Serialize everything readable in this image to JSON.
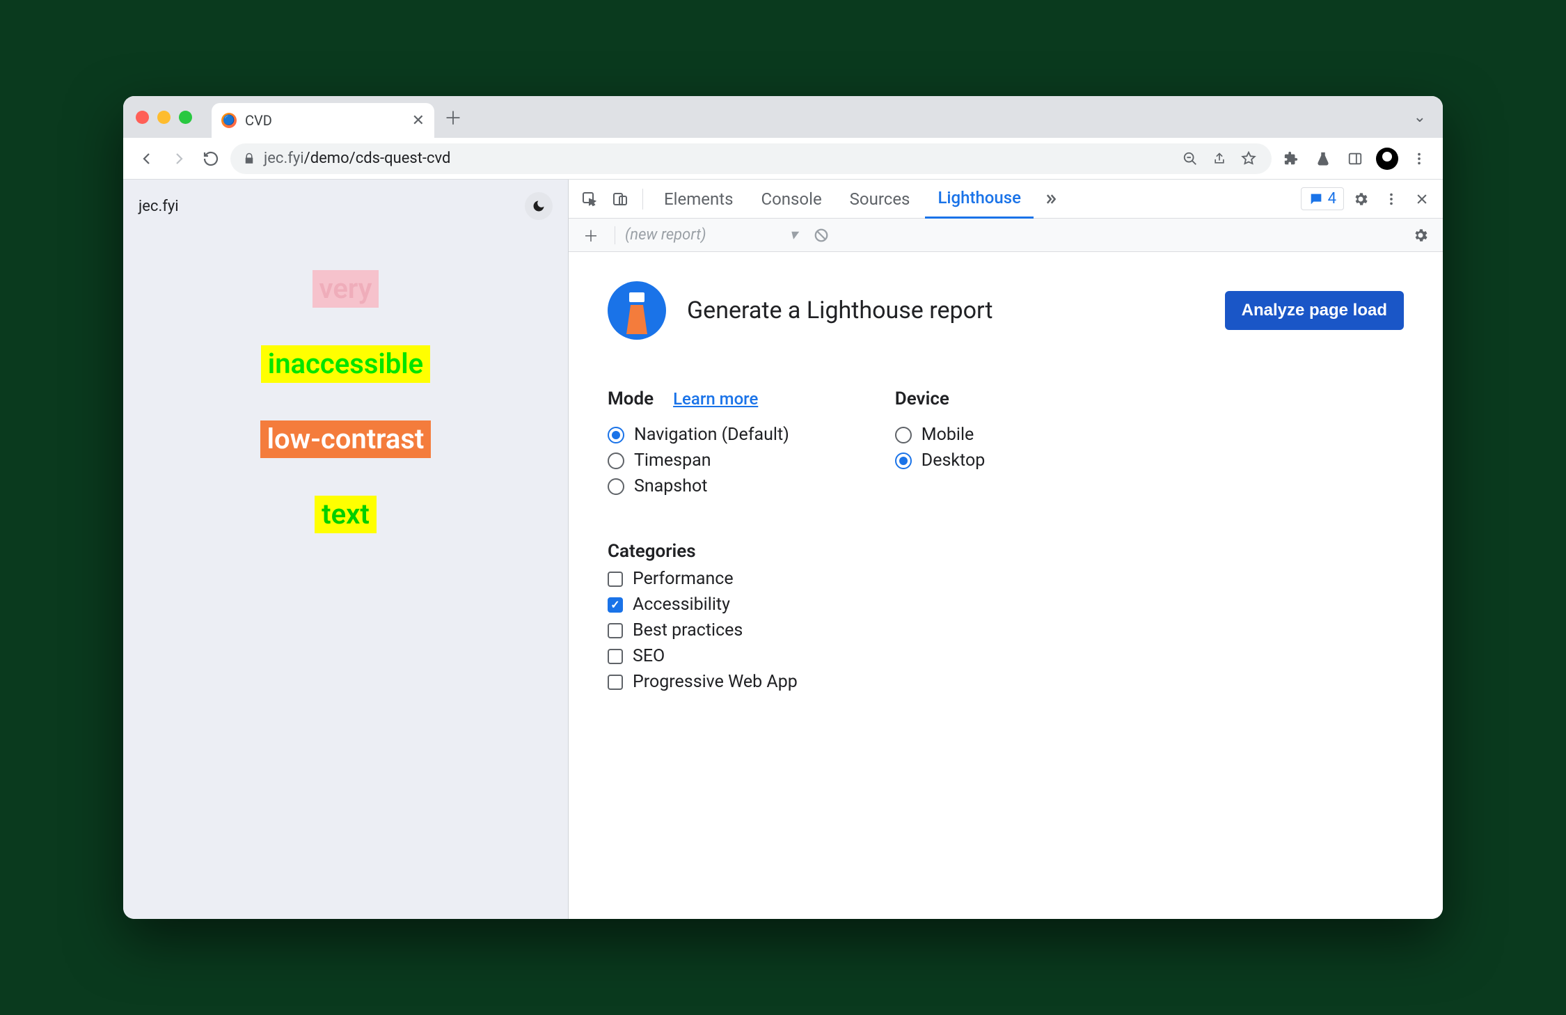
{
  "browser": {
    "tab_title": "CVD",
    "url_host": "jec.fyi",
    "url_path": "/demo/cds-quest-cvd"
  },
  "page": {
    "site_label": "jec.fyi",
    "words": [
      "very",
      "inaccessible",
      "low-contrast",
      "text"
    ]
  },
  "devtools": {
    "tabs": [
      "Elements",
      "Console",
      "Sources",
      "Lighthouse"
    ],
    "active_tab": "Lighthouse",
    "issues_count": "4",
    "subbar_label": "(new report)"
  },
  "lighthouse": {
    "title": "Generate a Lighthouse report",
    "cta": "Analyze page load",
    "mode_heading": "Mode",
    "learn_more": "Learn more",
    "modes": [
      {
        "label": "Navigation (Default)",
        "selected": true
      },
      {
        "label": "Timespan",
        "selected": false
      },
      {
        "label": "Snapshot",
        "selected": false
      }
    ],
    "device_heading": "Device",
    "devices": [
      {
        "label": "Mobile",
        "selected": false
      },
      {
        "label": "Desktop",
        "selected": true
      }
    ],
    "categories_heading": "Categories",
    "categories": [
      {
        "label": "Performance",
        "checked": false
      },
      {
        "label": "Accessibility",
        "checked": true
      },
      {
        "label": "Best practices",
        "checked": false
      },
      {
        "label": "SEO",
        "checked": false
      },
      {
        "label": "Progressive Web App",
        "checked": false
      }
    ]
  }
}
